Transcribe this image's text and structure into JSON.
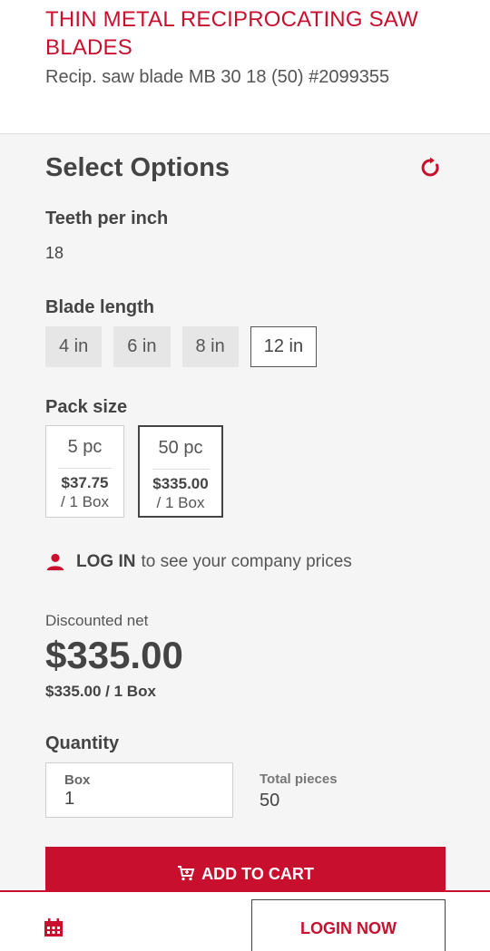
{
  "product": {
    "title": "THIN METAL RECIPROCATING SAW BLADES",
    "subtitle": "Recip. saw blade MB 30 18 (50) #2099355"
  },
  "options": {
    "heading": "Select Options",
    "teeth": {
      "label": "Teeth per inch",
      "value": "18"
    },
    "blade_length": {
      "label": "Blade length",
      "choices": [
        "4 in",
        "6 in",
        "8 in",
        "12 in"
      ],
      "selected": "12 in"
    },
    "pack_size": {
      "label": "Pack size",
      "packs": [
        {
          "size": "5 pc",
          "price": "$37.75",
          "unit": "/ 1 Box"
        },
        {
          "size": "50 pc",
          "price": "$335.00",
          "unit": "/ 1 Box"
        }
      ],
      "selected": "50 pc"
    }
  },
  "login_prompt": {
    "strong": "LOG IN",
    "rest": "to see your company prices"
  },
  "pricing": {
    "label": "Discounted net",
    "price": "$335.00",
    "per_unit": "$335.00 / 1 Box"
  },
  "quantity": {
    "label": "Quantity",
    "box_label": "Box",
    "box_value": "1",
    "total_label": "Total pieces",
    "total_value": "50"
  },
  "actions": {
    "add_to_cart": "ADD TO CART",
    "login_now": "LOGIN NOW"
  },
  "colors": {
    "accent": "#c8102e",
    "text": "#444444",
    "background": "#f5f5f5"
  },
  "icons": [
    "reset-icon",
    "user-icon",
    "cart-icon",
    "calendar-icon"
  ]
}
